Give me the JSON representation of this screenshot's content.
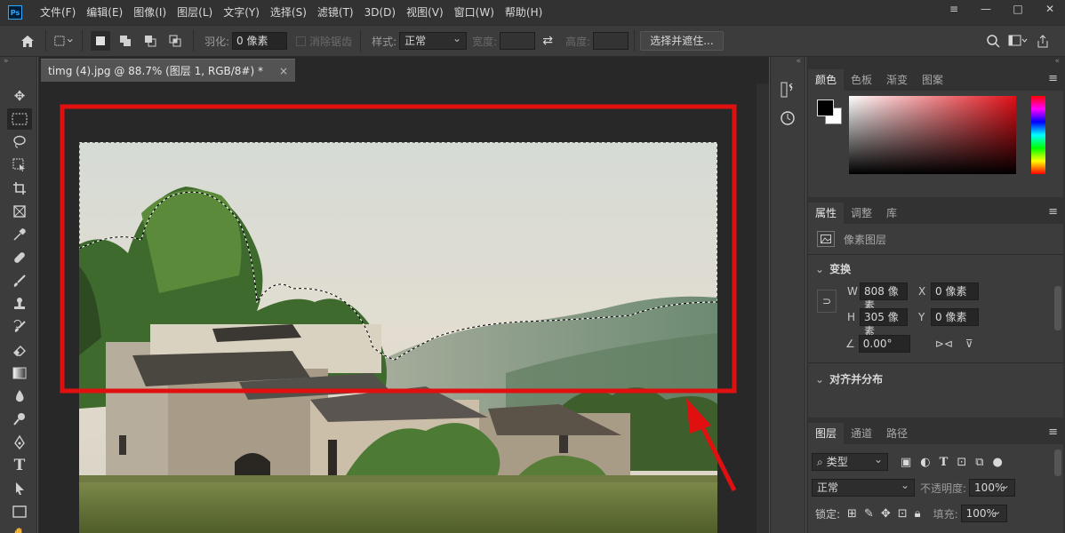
{
  "app": {
    "logo_text": "Ps",
    "menus": [
      "文件(F)",
      "编辑(E)",
      "图像(I)",
      "图层(L)",
      "文字(Y)",
      "选择(S)",
      "滤镜(T)",
      "3D(D)",
      "视图(V)",
      "窗口(W)",
      "帮助(H)"
    ],
    "window_controls": {
      "menu": "≡",
      "minimize": "—",
      "maximize": "□",
      "close": "✕"
    }
  },
  "options_bar": {
    "feather_label": "羽化:",
    "feather_value": "0 像素",
    "antialias_label": "消除锯齿",
    "style_label": "样式:",
    "style_value": "正常",
    "width_label": "宽度:",
    "height_label": "高度:",
    "select_mask_button": "选择并遮住..."
  },
  "document": {
    "tab_title": "timg (4).jpg @ 88.7% (图层 1, RGB/8#) *",
    "tab_close": "×"
  },
  "panels": {
    "color": {
      "tabs": [
        "颜色",
        "色板",
        "渐变",
        "图案"
      ],
      "active_tab": "颜色",
      "foreground": "#000000",
      "background": "#ffffff"
    },
    "properties": {
      "tabs": [
        "属性",
        "调整",
        "库"
      ],
      "active_tab": "属性",
      "layer_type": "像素图层",
      "transform_title": "变换",
      "w_label": "W",
      "w_value": "808 像素",
      "h_label": "H",
      "h_value": "305 像素",
      "x_label": "X",
      "x_value": "0 像素",
      "y_label": "Y",
      "y_value": "0 像素",
      "angle_value": "0.00°",
      "align_title": "对齐并分布"
    },
    "layers": {
      "tabs": [
        "图层",
        "通道",
        "路径"
      ],
      "active_tab": "图层",
      "filter_label": "类型",
      "blend_mode": "正常",
      "opacity_label": "不透明度:",
      "opacity_value": "100%",
      "lock_label": "锁定:",
      "fill_label": "填充:",
      "fill_value": "100%"
    }
  },
  "colors": {
    "highlight_box": "#e01010",
    "arrow": "#e01010",
    "ui_dark": "#282828",
    "panel": "#3c3c3c"
  }
}
